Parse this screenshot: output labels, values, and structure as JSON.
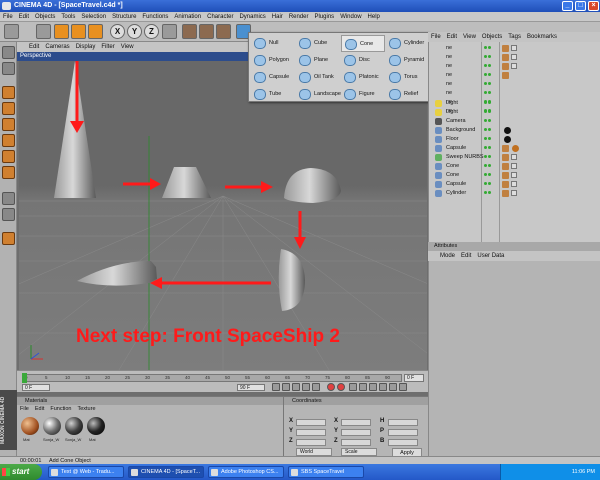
{
  "window": {
    "title": "CINEMA 4D - [SpaceTravel.c4d *]"
  },
  "menubar": [
    "File",
    "Edit",
    "Objects",
    "Tools",
    "Selection",
    "Structure",
    "Functions",
    "Animation",
    "Character",
    "Dynamics",
    "Hair",
    "Render",
    "Plugins",
    "Window",
    "Help"
  ],
  "viewport": {
    "menu": [
      "Edit",
      "Cameras",
      "Display",
      "Filter",
      "View"
    ],
    "tab": "Perspective",
    "annotation": "Next step: Front SpaceShip 2"
  },
  "palette": {
    "items": [
      "Null",
      "Polygon",
      "Capsule",
      "Tube",
      "Cube",
      "Plane",
      "Oil Tank",
      "Landscape",
      "Cone",
      "Disc",
      "Platonic",
      "Figure",
      "Cylinder",
      "Pyramid",
      "Torus",
      "Relief"
    ],
    "selected": "Cone"
  },
  "object_manager": {
    "menu": [
      "File",
      "Edit",
      "View",
      "Objects",
      "Tags",
      "Bookmarks"
    ],
    "objects": [
      "Light",
      "Light",
      "Camera",
      "Background",
      "Floor",
      "Capsule",
      "Sweep NURBS",
      "Cone",
      "Cone",
      "Capsule",
      "Cylinder"
    ],
    "partial_rows": [
      "ne",
      "ne",
      "ne",
      "ne",
      "ne",
      "ne",
      "ne",
      "ne"
    ]
  },
  "attributes": {
    "title": "Attributes",
    "menu": [
      "Mode",
      "Edit",
      "User Data"
    ]
  },
  "timeline": {
    "ticks": [
      "0",
      "5",
      "10",
      "15",
      "20",
      "25",
      "30",
      "35",
      "40",
      "45",
      "50",
      "55",
      "60",
      "65",
      "70",
      "75",
      "80",
      "85",
      "90"
    ],
    "start": "0 F",
    "end": "90 F",
    "current": "0 F"
  },
  "materials": {
    "title": "Materials",
    "menu": [
      "File",
      "Edit",
      "Function",
      "Texture"
    ],
    "items": [
      "Mat",
      "Sonja_W",
      "Sonja_W",
      "Mat"
    ]
  },
  "coordinates": {
    "title": "Coordinates",
    "labels": [
      "X",
      "Y",
      "Z",
      "X",
      "Y",
      "Z",
      "H",
      "P",
      "B"
    ],
    "dropdowns": [
      "World",
      "Scale"
    ],
    "apply": "Apply"
  },
  "status": {
    "time": "00:00:01",
    "message": "Add Cone Object"
  },
  "maxon_label": "MAXON CINEMA 4D",
  "taskbar": {
    "start": "start",
    "tasks": [
      "Text @ Web - Tradu...",
      "CINEMA 4D - [SpaceT...",
      "Adobe Photoshop CS...",
      "SBS SpaceTravel"
    ],
    "clock": "11:06 PM"
  },
  "colors": {
    "accent_red": "#ff1a1a",
    "viewport_bg": "#6e6e6e",
    "title_blue": "#2458c8"
  }
}
